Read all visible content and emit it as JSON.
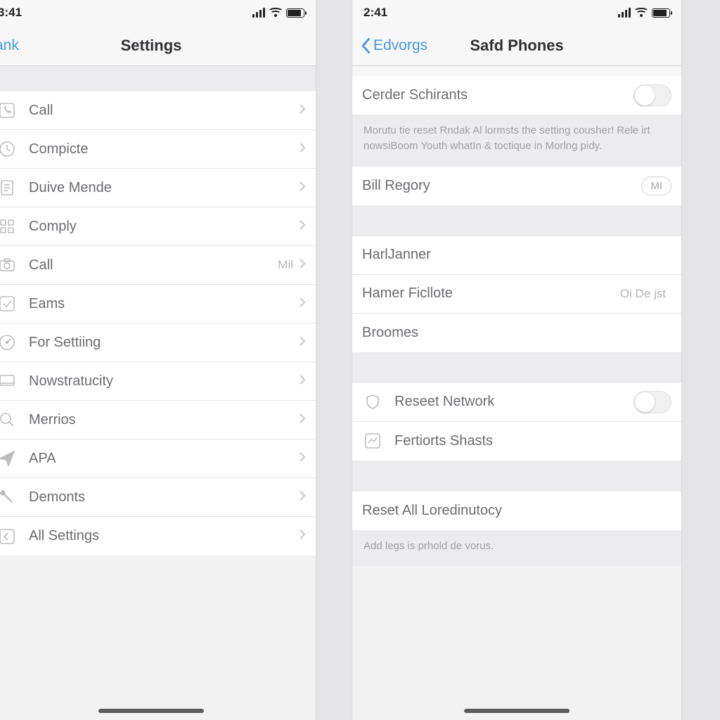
{
  "left": {
    "status_time": "3:41",
    "nav_back": "ank",
    "nav_title": "Settings",
    "rows": [
      {
        "icon": "phone-square-icon",
        "label": "Call",
        "detail": "",
        "chev": true
      },
      {
        "icon": "clock-icon",
        "label": "Compicte",
        "detail": "",
        "chev": true
      },
      {
        "icon": "doc-icon",
        "label": "Duive Mende",
        "detail": "",
        "chev": true
      },
      {
        "icon": "grid-icon",
        "label": "Comply",
        "detail": "",
        "chev": true
      },
      {
        "icon": "camera-icon",
        "label": "Call",
        "detail": "Mil",
        "chev": true
      },
      {
        "icon": "check-icon",
        "label": "Eams",
        "detail": "",
        "chev": true
      },
      {
        "icon": "gauge-icon",
        "label": "For Settiing",
        "detail": "",
        "chev": true
      },
      {
        "icon": "display-icon",
        "label": "Nowstratucity",
        "detail": "",
        "chev": true
      },
      {
        "icon": "search-icon",
        "label": "Merrios",
        "detail": "",
        "chev": true
      },
      {
        "icon": "send-icon",
        "label": "APA",
        "detail": "",
        "chev": true
      },
      {
        "icon": "mic-icon",
        "label": "Demonts",
        "detail": "",
        "chev": true
      },
      {
        "icon": "back-square-icon",
        "label": "All Settings",
        "detail": "",
        "chev": true
      }
    ]
  },
  "right": {
    "status_time": "2:41",
    "nav_back": "Edvorgs",
    "nav_title": "Safd Phones",
    "sec1": {
      "label": "Cerder Schirants",
      "footer": "Morutu tie reset Rndak Al lormsts the setting cousher! Rele irt nowsiBoom Youth whatIn & toctique in Morlng pidy."
    },
    "sec2": {
      "label": "Bill Regory",
      "pill": "MI"
    },
    "sec3": [
      {
        "label": "HarlJanner",
        "detail": ""
      },
      {
        "label": "Hamer Ficllote",
        "detail": "Oi De jst"
      },
      {
        "label": "Broomes",
        "detail": ""
      }
    ],
    "sec4": [
      {
        "icon": "shield-icon",
        "label": "Reseet Network",
        "toggle": true
      },
      {
        "icon": "chart-icon",
        "label": "Fertiorts Shasts",
        "toggle": false
      }
    ],
    "sec5": {
      "label": "Reset All Loredinutocy",
      "footer": "Add legs is prhold de vorus."
    }
  }
}
